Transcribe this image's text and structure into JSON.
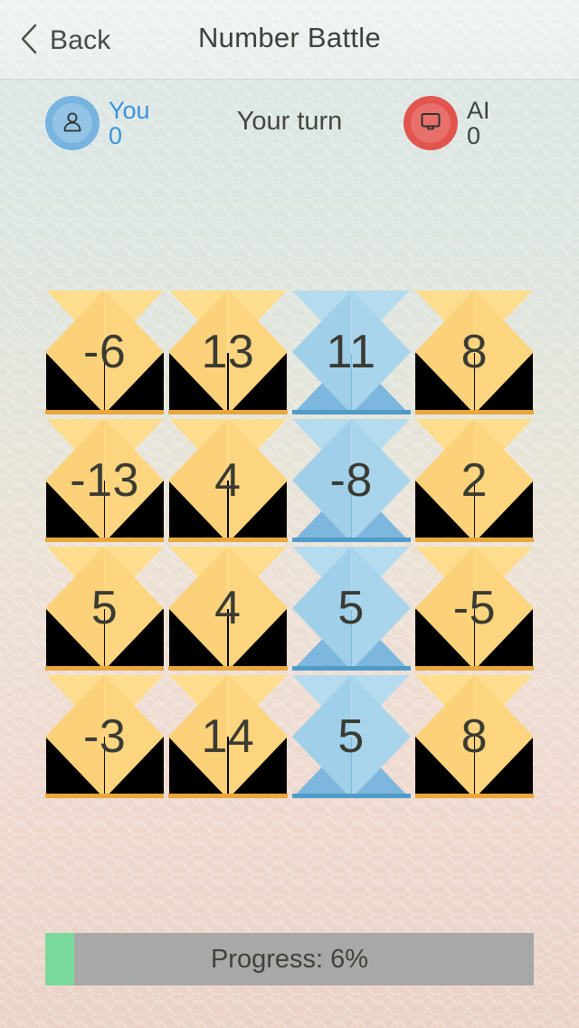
{
  "header": {
    "back_label": "Back",
    "back_icon": "chevron-left-icon",
    "title": "Number Battle"
  },
  "status": {
    "turn_text": "Your turn",
    "players": [
      {
        "id": "you",
        "name": "You",
        "score": "0",
        "icon": "person-icon",
        "avatar_color": "#78b4e0",
        "text_color": "#3b93dd"
      },
      {
        "id": "ai",
        "name": "AI",
        "score": "0",
        "icon": "monitor-icon",
        "avatar_color": "#e2544e",
        "text_color": "#3f433d"
      }
    ]
  },
  "board": {
    "rows": 4,
    "columns": 4,
    "owner_colors": {
      "neutral": "#fbd179",
      "player": "#9fcfe9"
    },
    "tiles": [
      {
        "value": "-6",
        "owner": "neutral"
      },
      {
        "value": "13",
        "owner": "neutral"
      },
      {
        "value": "11",
        "owner": "player"
      },
      {
        "value": "8",
        "owner": "neutral"
      },
      {
        "value": "-13",
        "owner": "neutral"
      },
      {
        "value": "4",
        "owner": "neutral"
      },
      {
        "value": "-8",
        "owner": "player"
      },
      {
        "value": "2",
        "owner": "neutral"
      },
      {
        "value": "5",
        "owner": "neutral"
      },
      {
        "value": "4",
        "owner": "neutral"
      },
      {
        "value": "5",
        "owner": "player"
      },
      {
        "value": "-5",
        "owner": "neutral"
      },
      {
        "value": "-3",
        "owner": "neutral"
      },
      {
        "value": "14",
        "owner": "neutral"
      },
      {
        "value": "5",
        "owner": "player"
      },
      {
        "value": "8",
        "owner": "neutral"
      }
    ]
  },
  "progress": {
    "label": "Progress: 6%",
    "percent": 6,
    "fill_color": "#79d99b",
    "track_color": "#a8a8a8"
  }
}
